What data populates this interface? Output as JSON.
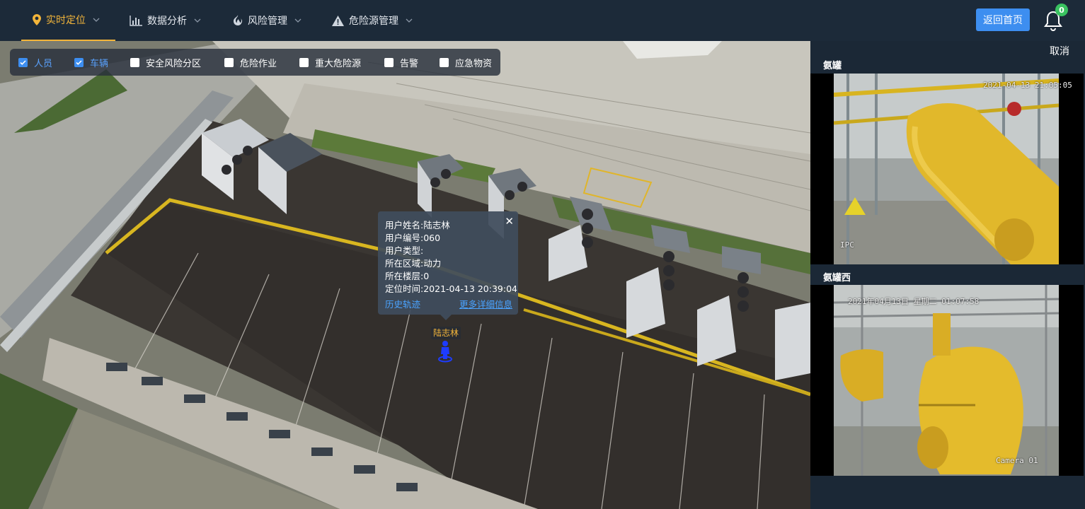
{
  "nav": {
    "items": [
      {
        "label": "实时定位",
        "icon": "location-pin-icon",
        "active": true
      },
      {
        "label": "数据分析",
        "icon": "bar-chart-icon",
        "active": false
      },
      {
        "label": "风险管理",
        "icon": "fire-icon",
        "active": false
      },
      {
        "label": "危险源管理",
        "icon": "warning-icon",
        "active": false
      }
    ],
    "home_label": "返回首页",
    "notification_count": "0"
  },
  "filters": [
    {
      "label": "人员",
      "checked": true
    },
    {
      "label": "车辆",
      "checked": true
    },
    {
      "label": "安全风险分区",
      "checked": false
    },
    {
      "label": "危险作业",
      "checked": false
    },
    {
      "label": "重大危险源",
      "checked": false
    },
    {
      "label": "告警",
      "checked": false
    },
    {
      "label": "应急物资",
      "checked": false
    }
  ],
  "popup": {
    "rows": [
      {
        "key": "用户姓名:",
        "value": "陆志林"
      },
      {
        "key": "用户编号:",
        "value": "060"
      },
      {
        "key": "用户类型:",
        "value": ""
      },
      {
        "key": "所在区域:",
        "value": "动力"
      },
      {
        "key": "所在楼层:",
        "value": "0"
      },
      {
        "key": "定位时间:",
        "value": "2021-04-13 20:39:04"
      }
    ],
    "close_label": "✕",
    "history_label": "历史轨迹",
    "detail_label": "更多详细信息"
  },
  "marker": {
    "name": "陆志林",
    "color": "#1e3cff"
  },
  "side": {
    "cancel_label": "取消",
    "cameras": [
      {
        "title": "氨罐",
        "timestamp": "2021-04-13 21:05:05",
        "corner": "IPC"
      },
      {
        "title": "氨罐西",
        "timestamp": "2021年04月13日 星期二 01:07:58",
        "corner": "Camera 01"
      }
    ]
  },
  "colors": {
    "accent": "#f3b53a",
    "primary": "#3d8ef0",
    "bg": "#1b2836"
  }
}
